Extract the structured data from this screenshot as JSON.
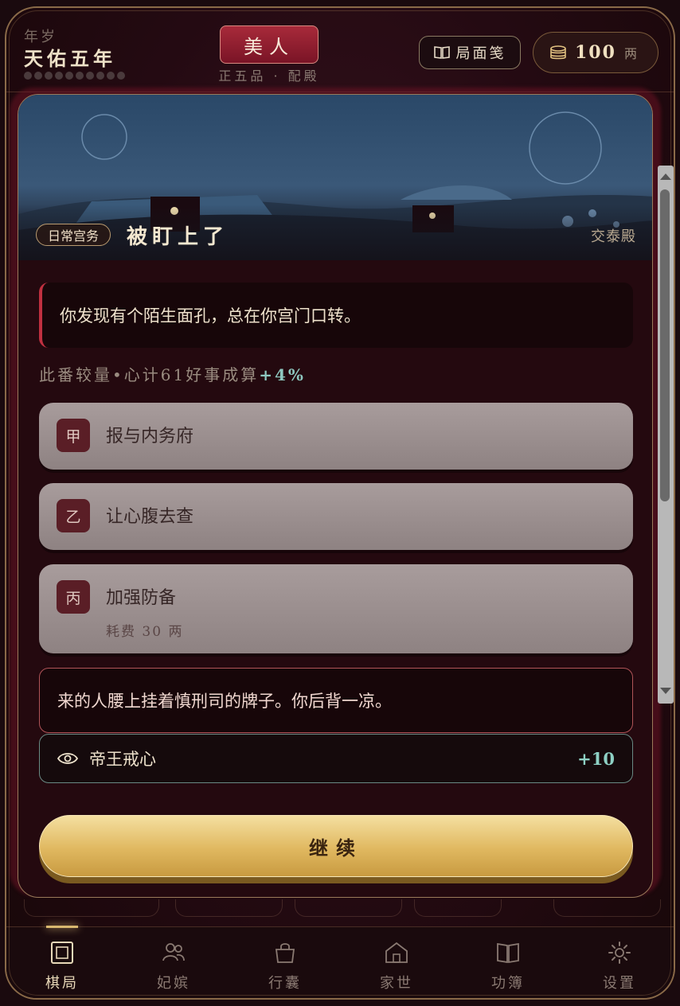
{
  "header": {
    "year_label": "年岁",
    "year_value": "天佑五年",
    "rank": "美人",
    "rank_sub": "正五品 · 配殿",
    "ledger_label": "局面笺",
    "money_value": "100",
    "money_unit": "两"
  },
  "event": {
    "tag": "日常宫务",
    "title": "被盯上了",
    "location": "交泰殿",
    "narrative": "你发现有个陌生面孔，总在你宫门口转。",
    "stats": {
      "label": "此番较量",
      "separator": "•",
      "attr_name": "心计",
      "attr_value": "61",
      "success_label": "好事成算",
      "success_bonus": "+4%"
    },
    "choices": [
      {
        "mark": "甲",
        "label": "报与内务府"
      },
      {
        "mark": "乙",
        "label": "让心腹去查"
      },
      {
        "mark": "丙",
        "label": "加强防备",
        "cost": "耗费 30 两"
      }
    ],
    "result": "来的人腰上挂着慎刑司的牌子。你后背一凉。",
    "effect": {
      "icon": "eye-icon",
      "label": "帝王戒心",
      "delta": "+10"
    },
    "continue_label": "继续"
  },
  "nav": [
    {
      "label": "棋局",
      "icon": "board-icon",
      "active": true
    },
    {
      "label": "妃嫔",
      "icon": "people-icon"
    },
    {
      "label": "行囊",
      "icon": "bag-icon"
    },
    {
      "label": "家世",
      "icon": "house-icon"
    },
    {
      "label": "功簿",
      "icon": "book-icon"
    },
    {
      "label": "设置",
      "icon": "gear-icon"
    }
  ],
  "colors": {
    "accent_red": "#a82a3a",
    "gold": "#e0b860",
    "teal": "#8ec8c0",
    "background": "#24090f"
  }
}
